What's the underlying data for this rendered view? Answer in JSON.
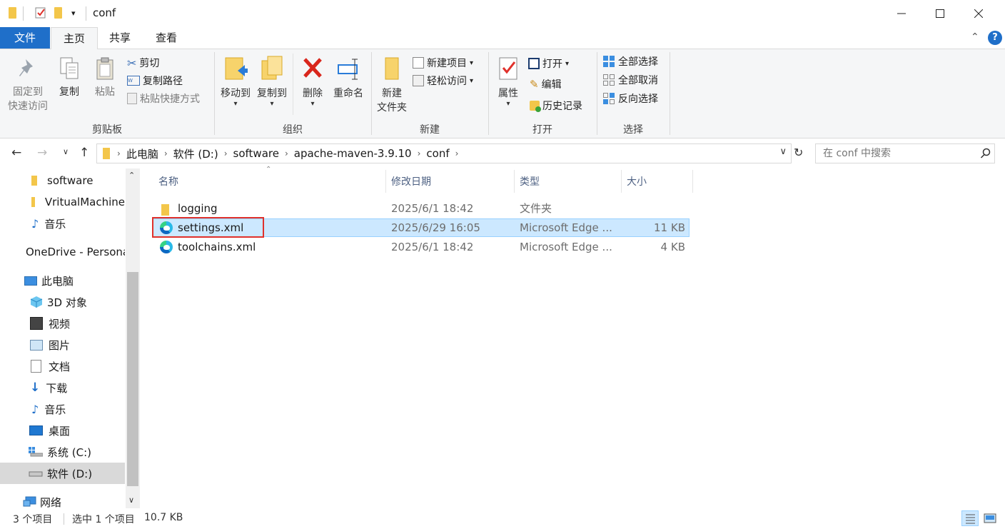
{
  "window": {
    "title": "conf"
  },
  "tabs": [
    "文件",
    "主页",
    "共享",
    "查看"
  ],
  "ribbon": {
    "clipboard": {
      "label": "剪贴板",
      "pin_line1": "固定到",
      "pin_line2": "快速访问",
      "copy": "复制",
      "paste": "粘贴",
      "cut": "剪切",
      "copy_path": "复制路径",
      "paste_shortcut": "粘贴快捷方式"
    },
    "organize": {
      "label": "组织",
      "move_to": "移动到",
      "copy_to": "复制到",
      "delete": "删除",
      "rename": "重命名"
    },
    "new": {
      "label": "新建",
      "new_folder_line1": "新建",
      "new_folder_line2": "文件夹",
      "new_item": "新建项目",
      "easy_access": "轻松访问"
    },
    "open": {
      "label": "打开",
      "properties": "属性",
      "open": "打开",
      "edit": "编辑",
      "history": "历史记录"
    },
    "select": {
      "label": "选择",
      "select_all": "全部选择",
      "select_none": "全部取消",
      "invert": "反向选择"
    }
  },
  "address": {
    "crumbs": [
      "此电脑",
      "软件 (D:)",
      "software",
      "apache-maven-3.9.10",
      "conf"
    ]
  },
  "search": {
    "placeholder": "在 conf 中搜索"
  },
  "nav": [
    "software",
    "VritualMachine",
    "音乐",
    "OneDrive - Personal",
    "此电脑",
    "3D 对象",
    "视频",
    "图片",
    "文档",
    "下载",
    "音乐",
    "桌面",
    "系统 (C:)",
    "软件 (D:)",
    "网络"
  ],
  "columns": {
    "name": "名称",
    "date": "修改日期",
    "type": "类型",
    "size": "大小"
  },
  "files": [
    {
      "name": "logging",
      "date": "2025/6/1 18:42",
      "type": "文件夹",
      "size": ""
    },
    {
      "name": "settings.xml",
      "date": "2025/6/29 16:05",
      "type": "Microsoft Edge ...",
      "size": "11 KB"
    },
    {
      "name": "toolchains.xml",
      "date": "2025/6/1 18:42",
      "type": "Microsoft Edge ...",
      "size": "4 KB"
    }
  ],
  "status": {
    "count": "3 个项目",
    "selected": "选中 1 个项目",
    "size": "10.7 KB"
  },
  "colors": {
    "accent": "#1f6fc9",
    "selection": "#cce8ff",
    "highlight": "#e0312b",
    "folder": "#f3c64a"
  }
}
